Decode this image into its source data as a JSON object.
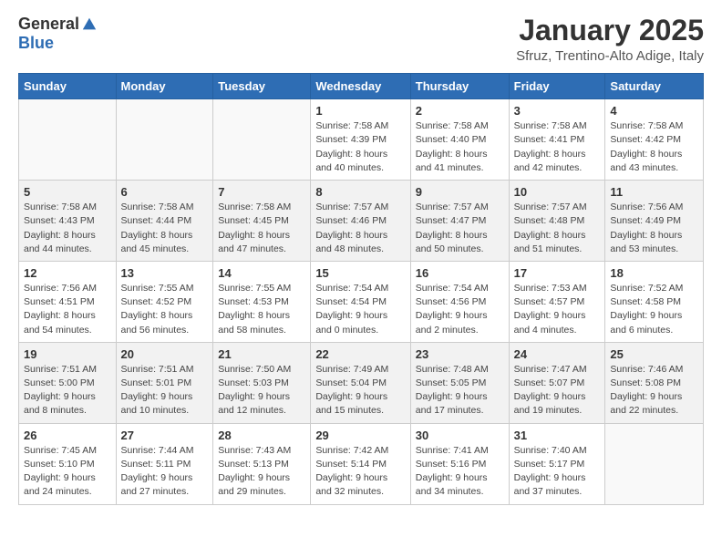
{
  "header": {
    "logo_general": "General",
    "logo_blue": "Blue",
    "month": "January 2025",
    "location": "Sfruz, Trentino-Alto Adige, Italy"
  },
  "weekdays": [
    "Sunday",
    "Monday",
    "Tuesday",
    "Wednesday",
    "Thursday",
    "Friday",
    "Saturday"
  ],
  "weeks": [
    [
      {
        "day": "",
        "info": ""
      },
      {
        "day": "",
        "info": ""
      },
      {
        "day": "",
        "info": ""
      },
      {
        "day": "1",
        "info": "Sunrise: 7:58 AM\nSunset: 4:39 PM\nDaylight: 8 hours\nand 40 minutes."
      },
      {
        "day": "2",
        "info": "Sunrise: 7:58 AM\nSunset: 4:40 PM\nDaylight: 8 hours\nand 41 minutes."
      },
      {
        "day": "3",
        "info": "Sunrise: 7:58 AM\nSunset: 4:41 PM\nDaylight: 8 hours\nand 42 minutes."
      },
      {
        "day": "4",
        "info": "Sunrise: 7:58 AM\nSunset: 4:42 PM\nDaylight: 8 hours\nand 43 minutes."
      }
    ],
    [
      {
        "day": "5",
        "info": "Sunrise: 7:58 AM\nSunset: 4:43 PM\nDaylight: 8 hours\nand 44 minutes."
      },
      {
        "day": "6",
        "info": "Sunrise: 7:58 AM\nSunset: 4:44 PM\nDaylight: 8 hours\nand 45 minutes."
      },
      {
        "day": "7",
        "info": "Sunrise: 7:58 AM\nSunset: 4:45 PM\nDaylight: 8 hours\nand 47 minutes."
      },
      {
        "day": "8",
        "info": "Sunrise: 7:57 AM\nSunset: 4:46 PM\nDaylight: 8 hours\nand 48 minutes."
      },
      {
        "day": "9",
        "info": "Sunrise: 7:57 AM\nSunset: 4:47 PM\nDaylight: 8 hours\nand 50 minutes."
      },
      {
        "day": "10",
        "info": "Sunrise: 7:57 AM\nSunset: 4:48 PM\nDaylight: 8 hours\nand 51 minutes."
      },
      {
        "day": "11",
        "info": "Sunrise: 7:56 AM\nSunset: 4:49 PM\nDaylight: 8 hours\nand 53 minutes."
      }
    ],
    [
      {
        "day": "12",
        "info": "Sunrise: 7:56 AM\nSunset: 4:51 PM\nDaylight: 8 hours\nand 54 minutes."
      },
      {
        "day": "13",
        "info": "Sunrise: 7:55 AM\nSunset: 4:52 PM\nDaylight: 8 hours\nand 56 minutes."
      },
      {
        "day": "14",
        "info": "Sunrise: 7:55 AM\nSunset: 4:53 PM\nDaylight: 8 hours\nand 58 minutes."
      },
      {
        "day": "15",
        "info": "Sunrise: 7:54 AM\nSunset: 4:54 PM\nDaylight: 9 hours\nand 0 minutes."
      },
      {
        "day": "16",
        "info": "Sunrise: 7:54 AM\nSunset: 4:56 PM\nDaylight: 9 hours\nand 2 minutes."
      },
      {
        "day": "17",
        "info": "Sunrise: 7:53 AM\nSunset: 4:57 PM\nDaylight: 9 hours\nand 4 minutes."
      },
      {
        "day": "18",
        "info": "Sunrise: 7:52 AM\nSunset: 4:58 PM\nDaylight: 9 hours\nand 6 minutes."
      }
    ],
    [
      {
        "day": "19",
        "info": "Sunrise: 7:51 AM\nSunset: 5:00 PM\nDaylight: 9 hours\nand 8 minutes."
      },
      {
        "day": "20",
        "info": "Sunrise: 7:51 AM\nSunset: 5:01 PM\nDaylight: 9 hours\nand 10 minutes."
      },
      {
        "day": "21",
        "info": "Sunrise: 7:50 AM\nSunset: 5:03 PM\nDaylight: 9 hours\nand 12 minutes."
      },
      {
        "day": "22",
        "info": "Sunrise: 7:49 AM\nSunset: 5:04 PM\nDaylight: 9 hours\nand 15 minutes."
      },
      {
        "day": "23",
        "info": "Sunrise: 7:48 AM\nSunset: 5:05 PM\nDaylight: 9 hours\nand 17 minutes."
      },
      {
        "day": "24",
        "info": "Sunrise: 7:47 AM\nSunset: 5:07 PM\nDaylight: 9 hours\nand 19 minutes."
      },
      {
        "day": "25",
        "info": "Sunrise: 7:46 AM\nSunset: 5:08 PM\nDaylight: 9 hours\nand 22 minutes."
      }
    ],
    [
      {
        "day": "26",
        "info": "Sunrise: 7:45 AM\nSunset: 5:10 PM\nDaylight: 9 hours\nand 24 minutes."
      },
      {
        "day": "27",
        "info": "Sunrise: 7:44 AM\nSunset: 5:11 PM\nDaylight: 9 hours\nand 27 minutes."
      },
      {
        "day": "28",
        "info": "Sunrise: 7:43 AM\nSunset: 5:13 PM\nDaylight: 9 hours\nand 29 minutes."
      },
      {
        "day": "29",
        "info": "Sunrise: 7:42 AM\nSunset: 5:14 PM\nDaylight: 9 hours\nand 32 minutes."
      },
      {
        "day": "30",
        "info": "Sunrise: 7:41 AM\nSunset: 5:16 PM\nDaylight: 9 hours\nand 34 minutes."
      },
      {
        "day": "31",
        "info": "Sunrise: 7:40 AM\nSunset: 5:17 PM\nDaylight: 9 hours\nand 37 minutes."
      },
      {
        "day": "",
        "info": ""
      }
    ]
  ]
}
